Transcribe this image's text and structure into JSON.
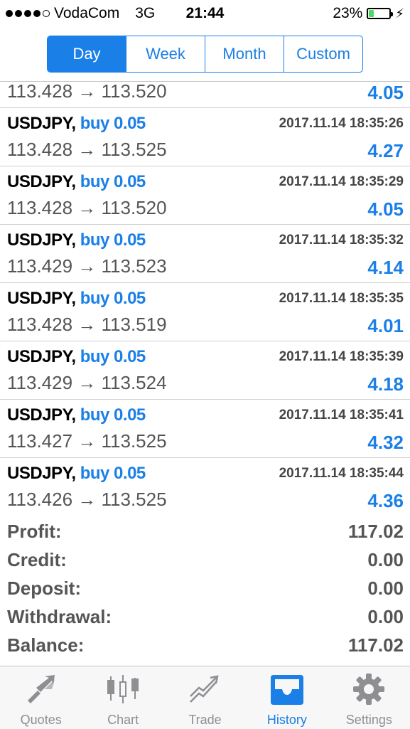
{
  "status_bar": {
    "carrier": "VodaCom",
    "network": "3G",
    "time": "21:44",
    "battery": "23%",
    "battery_level": 0.23,
    "signal_bars": 4
  },
  "period_tabs": [
    {
      "label": "Day",
      "active": true
    },
    {
      "label": "Week",
      "active": false
    },
    {
      "label": "Month",
      "active": false
    },
    {
      "label": "Custom",
      "active": false
    }
  ],
  "partial_row": {
    "prices": "113.428 → 113.520",
    "profit": "4.05"
  },
  "deals": [
    {
      "symbol": "USDJPY,",
      "side": "buy 0.05",
      "time": "2017.11.14 18:35:26",
      "prices": "113.428 → 113.525",
      "profit": "4.27"
    },
    {
      "symbol": "USDJPY,",
      "side": "buy 0.05",
      "time": "2017.11.14 18:35:29",
      "prices": "113.428 → 113.520",
      "profit": "4.05"
    },
    {
      "symbol": "USDJPY,",
      "side": "buy 0.05",
      "time": "2017.11.14 18:35:32",
      "prices": "113.429 → 113.523",
      "profit": "4.14"
    },
    {
      "symbol": "USDJPY,",
      "side": "buy 0.05",
      "time": "2017.11.14 18:35:35",
      "prices": "113.428 → 113.519",
      "profit": "4.01"
    },
    {
      "symbol": "USDJPY,",
      "side": "buy 0.05",
      "time": "2017.11.14 18:35:39",
      "prices": "113.429 → 113.524",
      "profit": "4.18"
    },
    {
      "symbol": "USDJPY,",
      "side": "buy 0.05",
      "time": "2017.11.14 18:35:41",
      "prices": "113.427 → 113.525",
      "profit": "4.32"
    },
    {
      "symbol": "USDJPY,",
      "side": "buy 0.05",
      "time": "2017.11.14 18:35:44",
      "prices": "113.426 → 113.525",
      "profit": "4.36"
    }
  ],
  "summary": [
    {
      "label": "Profit:",
      "value": "117.02"
    },
    {
      "label": "Credit:",
      "value": "0.00"
    },
    {
      "label": "Deposit:",
      "value": "0.00"
    },
    {
      "label": "Withdrawal:",
      "value": "0.00"
    },
    {
      "label": "Balance:",
      "value": "117.02"
    }
  ],
  "tab_bar": [
    {
      "label": "Quotes",
      "icon": "quotes-icon",
      "active": false
    },
    {
      "label": "Chart",
      "icon": "candlestick-chart-icon",
      "active": false
    },
    {
      "label": "Trade",
      "icon": "trade-trend-icon",
      "active": false
    },
    {
      "label": "History",
      "icon": "inbox-tray-icon",
      "active": true
    },
    {
      "label": "Settings",
      "icon": "gear-icon",
      "active": false
    }
  ],
  "colors": {
    "accent": "#1a7fe6",
    "inactive_tab": "#8e8e93",
    "battery_fill": "#4cd964",
    "muted_text": "#555555"
  }
}
